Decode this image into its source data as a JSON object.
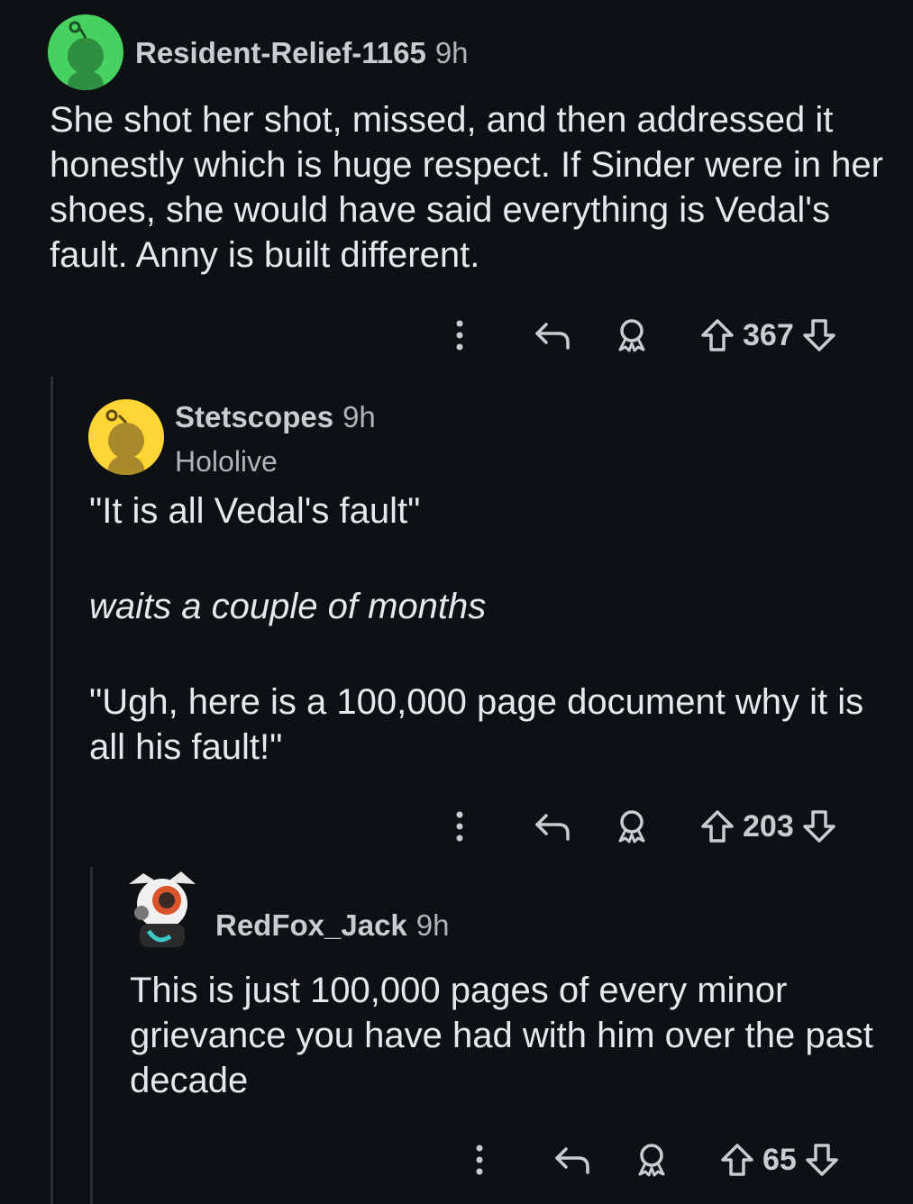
{
  "comments": [
    {
      "username": "Resident-Relief-1165",
      "time": "9h",
      "avatar": "snoo-avatar-green",
      "body": "She shot her shot, missed, and then addressed it honestly which is huge respect. If Sinder were in her shoes, she would have said everything is Vedal's fault. Anny is built different.",
      "score": "367"
    },
    {
      "username": "Stetscopes",
      "time": "9h",
      "flair": "Hololive",
      "avatar": "snoo-avatar-yellow",
      "body_lines": [
        "\"It is all Vedal's fault\"",
        "waits a couple of months",
        "\"Ugh, here is a 100,000 page document why it is all his fault!\""
      ],
      "score": "203"
    },
    {
      "username": "RedFox_Jack",
      "time": "9h",
      "avatar": "custom-avatar-redfox",
      "body": "This is just 100,000 pages of every minor grievance you have had with him over the past decade",
      "score": "65"
    }
  ],
  "icons": {
    "more": "more-options-icon",
    "reply": "reply-icon",
    "award": "award-icon",
    "upvote": "upvote-icon",
    "downvote": "downvote-icon"
  },
  "colors": {
    "background": "#0e1113",
    "text": "#e6e9ea",
    "muted": "#aeb4b7",
    "thread_line": "#2a2f33",
    "avatar_green": "#46d160",
    "avatar_yellow": "#ffd635"
  }
}
